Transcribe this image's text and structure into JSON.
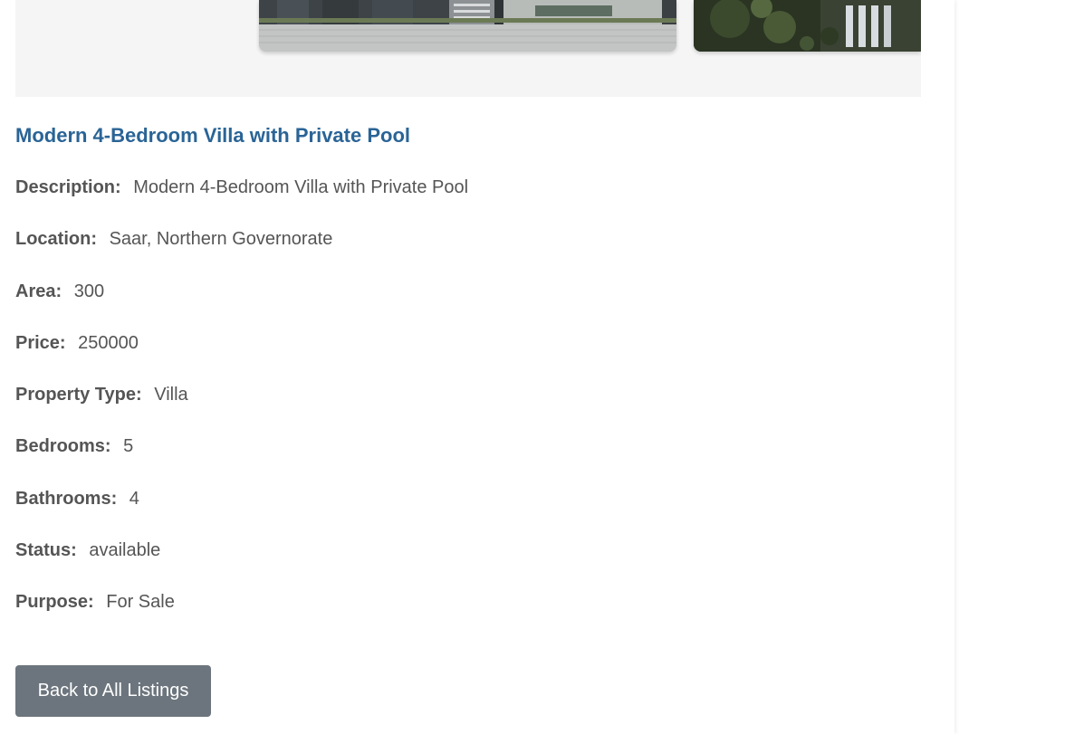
{
  "listing": {
    "title": "Modern 4-Bedroom Villa with Private Pool",
    "details": [
      {
        "label": "Description:",
        "value": "Modern 4-Bedroom Villa with Private Pool"
      },
      {
        "label": "Location:",
        "value": "Saar, Northern Governorate"
      },
      {
        "label": "Area:",
        "value": "300"
      },
      {
        "label": "Price:",
        "value": "250000"
      },
      {
        "label": "Property Type:",
        "value": "Villa"
      },
      {
        "label": "Bedrooms:",
        "value": "5"
      },
      {
        "label": "Bathrooms:",
        "value": "4"
      },
      {
        "label": "Status:",
        "value": "available"
      },
      {
        "label": "Purpose:",
        "value": "For Sale"
      }
    ]
  },
  "actions": {
    "back_label": "Back to All Listings"
  },
  "colors": {
    "title": "#2a6496",
    "button_bg": "#6c757d",
    "gallery_bg": "#f5f5f5"
  }
}
